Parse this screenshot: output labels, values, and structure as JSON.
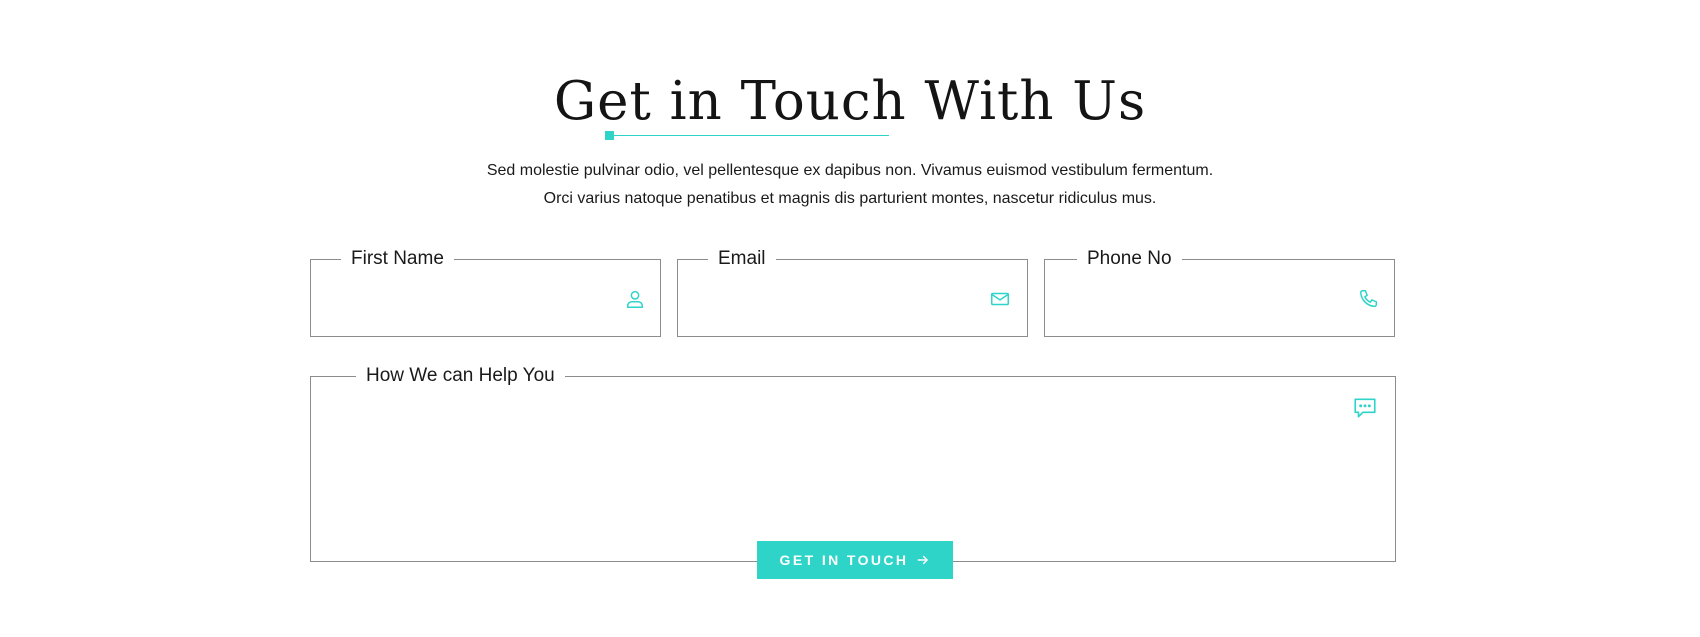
{
  "section": {
    "title": "Get in Touch With Us",
    "intro_line_1": "Sed molestie pulvinar odio, vel pellentesque ex dapibus non. Vivamus euismod vestibulum fermentum.",
    "intro_line_2": "Orci varius natoque penatibus et magnis dis parturient montes, nascetur ridiculus mus.",
    "accent_color": "#2dd4c7"
  },
  "form": {
    "first_name": {
      "label": "First Name",
      "value": "",
      "icon": "user-icon"
    },
    "email": {
      "label": "Email",
      "value": "",
      "icon": "envelope-icon"
    },
    "phone": {
      "label": "Phone No",
      "value": "",
      "icon": "phone-icon"
    },
    "message": {
      "label": "How We can Help You",
      "value": "",
      "icon": "chat-bubble-icon"
    },
    "submit": {
      "label": "GET IN TOUCH",
      "icon": "arrow-right-icon"
    }
  }
}
